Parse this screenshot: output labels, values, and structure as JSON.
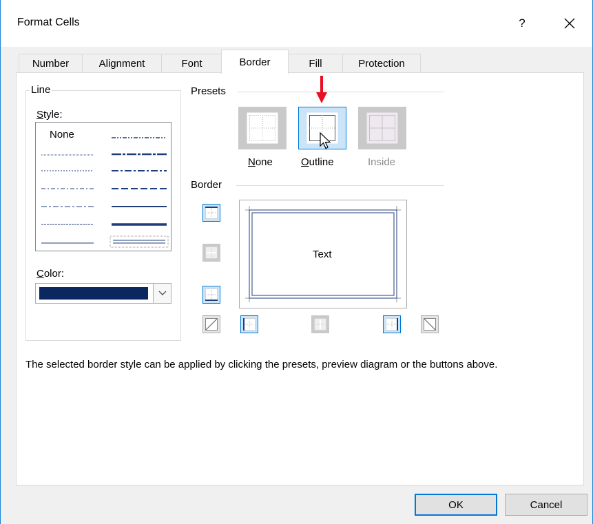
{
  "dialog": {
    "title": "Format Cells",
    "help_label": "?",
    "close_icon": "close-icon"
  },
  "tabs": [
    {
      "label": "Number",
      "active": false
    },
    {
      "label": "Alignment",
      "active": false
    },
    {
      "label": "Font",
      "active": false
    },
    {
      "label": "Border",
      "active": true
    },
    {
      "label": "Fill",
      "active": false
    },
    {
      "label": "Protection",
      "active": false
    }
  ],
  "line_group": {
    "title": "Line",
    "style_label_access": "S",
    "style_label_rest": "tyle:",
    "style_none": "None",
    "color_label_access": "C",
    "color_label_rest": "olor:",
    "color_value": "#0b2760"
  },
  "presets": {
    "title": "Presets",
    "none_access": "N",
    "none_rest": "one",
    "outline_access": "O",
    "outline_rest": "utline",
    "inside": "Inside",
    "selected": "Outline"
  },
  "border": {
    "title": "Border",
    "preview_text": "Text"
  },
  "footer": {
    "message": "The selected border style can be applied by clicking the presets, preview diagram or the buttons above."
  },
  "buttons": {
    "ok": "OK",
    "cancel": "Cancel"
  },
  "colors": {
    "accent": "#0078d7",
    "border_blue": "#1f3d7a",
    "arrow_red": "#e81123",
    "selected_bg": "#cce4f7"
  }
}
